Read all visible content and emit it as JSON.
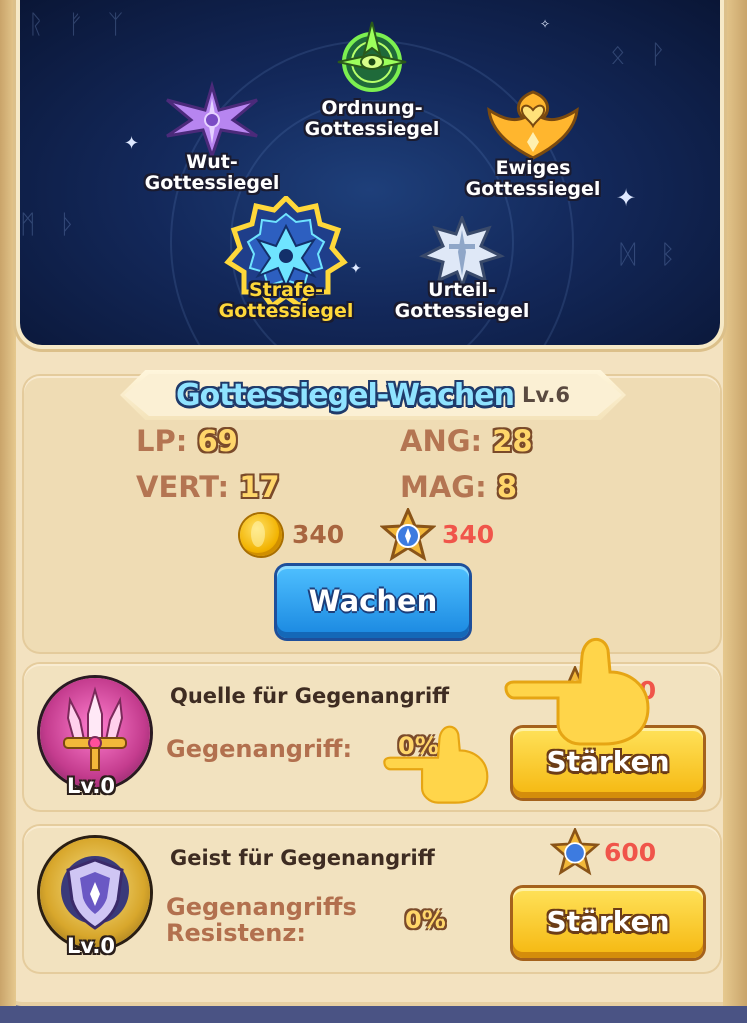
{
  "seals": {
    "order": {
      "line1": "Ordnung-",
      "line2": "Gottessiegel"
    },
    "wrath": {
      "line1": "Wut-",
      "line2": "Gottessiegel"
    },
    "eternal": {
      "line1": "Ewiges",
      "line2": "Gottessiegel"
    },
    "punishment": {
      "line1": "Strafe-",
      "line2": "Gottessiegel"
    },
    "judgment": {
      "line1": "Urteil-",
      "line2": "Gottessiegel"
    }
  },
  "awaken": {
    "title": "Gottessiegel-Wachen",
    "level": "Lv.6",
    "stats": {
      "lp_label": "LP:",
      "lp_value": "69",
      "ang_label": "ANG:",
      "ang_value": "28",
      "vert_label": "VERT:",
      "vert_value": "17",
      "mag_label": "MAG:",
      "mag_value": "8"
    },
    "gold_cost": "340",
    "star_cost": "340",
    "button": "Wachen"
  },
  "upgrades": [
    {
      "name": "Quelle für Gegenangriff",
      "stat_label": "Gegenangriff:",
      "stat_value": "0%",
      "cost": "600",
      "level": "Lv.0",
      "button": "Stärken"
    },
    {
      "name": "Geist für Gegenangriff",
      "stat_label_line1": "Gegenangriffs",
      "stat_label_line2": "Resistenz:",
      "stat_value": "0%",
      "cost": "600",
      "level": "Lv.0",
      "button": "Stärken"
    }
  ],
  "colors": {
    "title": "#8fe3ff",
    "active_seal_label": "#ffd83a",
    "cost_red": "#f0554a",
    "cost_brown": "#a8653f",
    "stat_label": "#b47552",
    "stat_value": "#ffd66a"
  },
  "icons": {
    "gold": "gold-coin-icon",
    "star": "star-seal-token-icon",
    "tutorial": "pointing-hand-icon"
  }
}
